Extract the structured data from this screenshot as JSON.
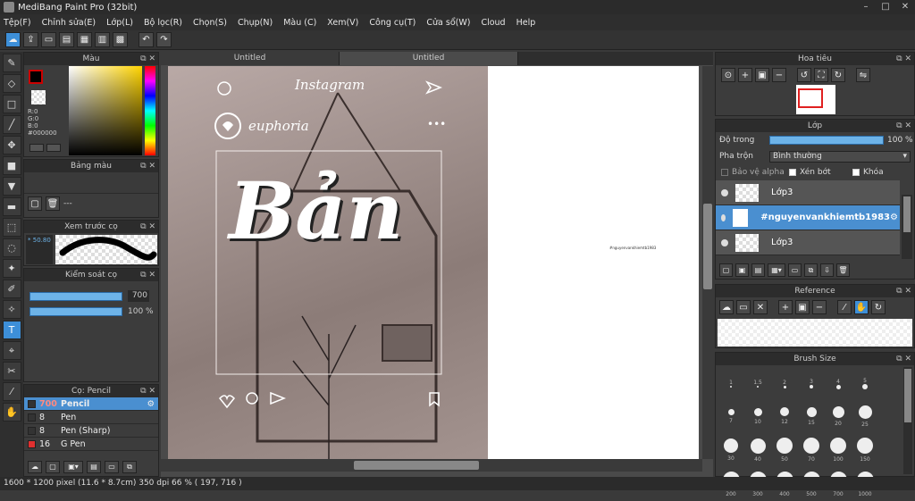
{
  "window": {
    "title": "MediBang Paint Pro (32bit)"
  },
  "menu": [
    "Tệp(F)",
    "Chỉnh sửa(E)",
    "Lớp(L)",
    "Bộ lọc(R)",
    "Chọn(S)",
    "Chụp(N)",
    "Màu (C)",
    "Xem(V)",
    "Công cụ(T)",
    "Cửa sổ(W)",
    "Cloud",
    "Help"
  ],
  "tabs": [
    "Untitled",
    "Untitled"
  ],
  "color_panel": {
    "title": "Màu",
    "r": "R:0",
    "g": "G:0",
    "b": "B:0",
    "hex": "#000000",
    "primary": "#cc0000"
  },
  "palette_panel": {
    "title": "Bảng màu",
    "placeholder": "---"
  },
  "brush_preview": {
    "title": "Xem trước cọ",
    "size": "50.80"
  },
  "brush_control": {
    "title": "Kiểm soát cọ",
    "size": "700",
    "opacity": "100 %"
  },
  "brush_list": {
    "title": "Cọ: Pencil",
    "items": [
      {
        "size": "700",
        "name": "Pencil",
        "color": "#333333",
        "selected": true
      },
      {
        "size": "8",
        "name": "Pen",
        "color": "#333333",
        "selected": false
      },
      {
        "size": "8",
        "name": "Pen (Sharp)",
        "color": "#333333",
        "selected": false
      },
      {
        "size": "16",
        "name": "G Pen",
        "color": "#e03030",
        "selected": false
      }
    ]
  },
  "navigator": {
    "title": "Hoa tiêu"
  },
  "layer_panel": {
    "title": "Lớp",
    "opacity_label": "Độ trong",
    "opacity_value": "100 %",
    "blend_label": "Pha trộn",
    "blend_value": "Bình thường",
    "protect_alpha": "Bảo vệ alpha",
    "clipping": "Xén bớt",
    "lock": "Khóa",
    "layers": [
      {
        "name": "Lớp3",
        "selected": false
      },
      {
        "name": "#nguyenvankhiemtb1983",
        "selected": true
      },
      {
        "name": "Lớp3",
        "selected": false
      }
    ]
  },
  "reference_panel": {
    "title": "Reference"
  },
  "brush_size_panel": {
    "title": "Brush Size",
    "sizes": [
      "1",
      "1.5",
      "2",
      "3",
      "4",
      "5",
      "7",
      "10",
      "12",
      "15",
      "20",
      "25",
      "30",
      "40",
      "50",
      "70",
      "100",
      "150",
      "200",
      "300",
      "400",
      "500",
      "700",
      "1000"
    ]
  },
  "canvas": {
    "instagram": "Instagram",
    "username": "euphoria",
    "big_text": "Bản",
    "small_note": "#nguyenvankhiemtb1983"
  },
  "status": "1600 * 1200 pixel   (11.6 * 8.7cm)   350 dpi   66 %   ( 197, 716 )"
}
